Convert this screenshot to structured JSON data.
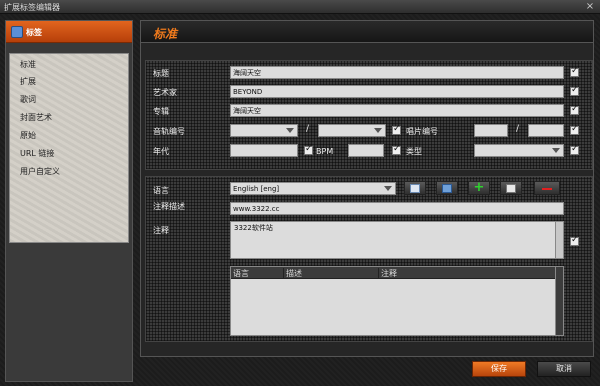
{
  "window": {
    "title": "扩展标签编辑器",
    "close_glyph": "×"
  },
  "sidebar": {
    "header": "标签",
    "items": [
      {
        "label": "标准"
      },
      {
        "label": "扩展"
      },
      {
        "label": "歌词"
      },
      {
        "label": "封面艺术"
      },
      {
        "label": "原始"
      },
      {
        "label": "URL 链接"
      },
      {
        "label": "用户自定义"
      }
    ]
  },
  "main": {
    "header": "标准"
  },
  "standard": {
    "title_label": "标题",
    "title_value": "海阔天空",
    "artist_label": "艺术家",
    "artist_value": "BEYOND",
    "album_label": "专辑",
    "album_value": "海阔天空",
    "track_label": "音轨编号",
    "track_sep": "/",
    "disc_label": "唱片编号",
    "disc_sep": "/",
    "year_label": "年代",
    "bpm_label": "BPM",
    "genre_label": "类型"
  },
  "comments": {
    "language_label": "语言",
    "language_value": "English [eng]",
    "desc_label": "注释描述",
    "desc_value": "www.3322.cc",
    "comment_label": "注释",
    "comment_value": "3322软件站",
    "toolbar_plus": "+",
    "table_columns": [
      "语言",
      "描述",
      "注释"
    ]
  },
  "footer": {
    "save": "保存",
    "cancel": "取消"
  }
}
